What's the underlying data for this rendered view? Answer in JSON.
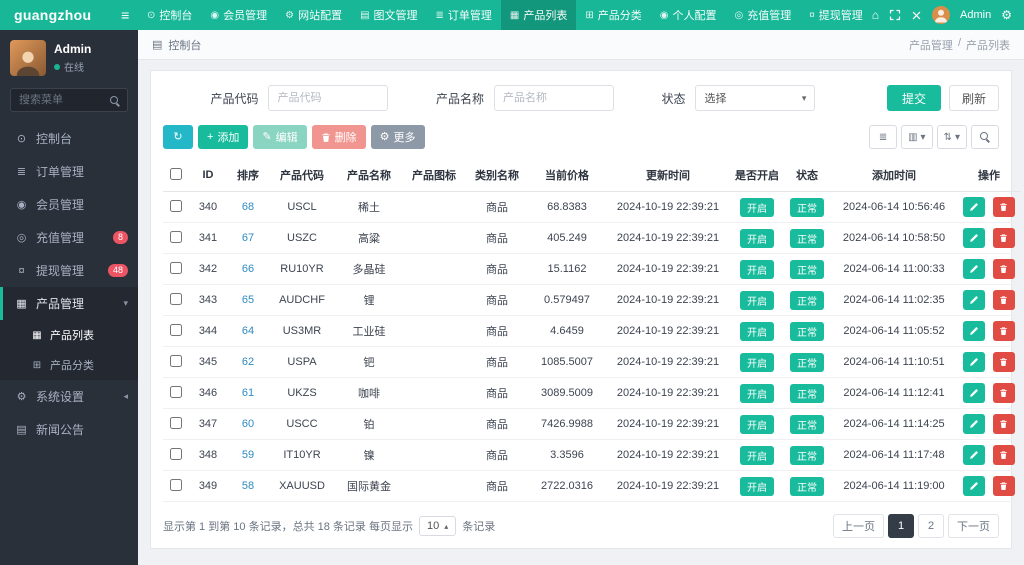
{
  "colors": {
    "accent": "#18bc9c",
    "danger": "#ed5565",
    "topbar": "#17b798",
    "sidebar": "#2a303a",
    "info": "#23b7c8"
  },
  "icons": {
    "menu_toggle": "≡",
    "home": "⌂",
    "gear": "⚙",
    "caret_down": "▾",
    "caret_left": "◂",
    "caret_up": "▴",
    "refresh": "↻",
    "plus": "+",
    "pencil": "✎",
    "list_view": "≣",
    "columns": "▥",
    "sort": "⇅"
  },
  "topbar": {
    "brand": "guangzhou",
    "user": "Admin",
    "nav": [
      {
        "label": "控制台",
        "glyph": "⊙"
      },
      {
        "label": "会员管理",
        "glyph": "◉"
      },
      {
        "label": "网站配置",
        "glyph": "⚙"
      },
      {
        "label": "图文管理",
        "glyph": "▤"
      },
      {
        "label": "订单管理",
        "glyph": "≣"
      },
      {
        "label": "产品列表",
        "glyph": "▦"
      },
      {
        "label": "产品分类",
        "glyph": "⊞"
      },
      {
        "label": "个人配置",
        "glyph": "◉"
      },
      {
        "label": "充值管理",
        "glyph": "◎"
      },
      {
        "label": "提现管理",
        "glyph": "¤"
      }
    ]
  },
  "sidebar": {
    "user_name": "Admin",
    "online_status": "在线",
    "search_placeholder": "搜索菜单",
    "items": [
      {
        "label": "控制台",
        "glyph": "⊙"
      },
      {
        "label": "订单管理",
        "glyph": "≣"
      },
      {
        "label": "会员管理",
        "glyph": "◉"
      },
      {
        "label": "充值管理",
        "glyph": "◎",
        "badge": "8"
      },
      {
        "label": "提现管理",
        "glyph": "¤",
        "badge": "48"
      },
      {
        "label": "产品管理",
        "glyph": "▦",
        "caret": "▾"
      },
      {
        "label": "系统设置",
        "glyph": "⚙",
        "caret": "◂"
      },
      {
        "label": "新闻公告",
        "glyph": "▤"
      }
    ],
    "sub_items": [
      {
        "label": "产品列表",
        "glyph": "▦"
      },
      {
        "label": "产品分类",
        "glyph": "⊞"
      }
    ]
  },
  "breadcrumb": {
    "left": "控制台",
    "section": "产品管理",
    "separator": "/",
    "page": "产品列表"
  },
  "filters": {
    "code_label": "产品代码",
    "code_placeholder": "产品代码",
    "name_label": "产品名称",
    "name_placeholder": "产品名称",
    "status_label": "状态",
    "status_value": "选择",
    "submit_label": "提交",
    "reset_label": "刷新"
  },
  "toolbar": {
    "add_label": "添加",
    "edit_label": "编辑",
    "delete_label": "删除",
    "more_label": "更多"
  },
  "table": {
    "headers": [
      "ID",
      "排序",
      "产品代码",
      "产品名称",
      "产品图标",
      "类别名称",
      "当前价格",
      "更新时间",
      "是否开启",
      "状态",
      "添加时间",
      "操作"
    ],
    "rows": [
      {
        "id": "340",
        "sort": "68",
        "code": "USCL",
        "name": "稀土",
        "category": "商品",
        "price": "68.8383",
        "updated_at": "2024-10-19 22:39:21",
        "open_label": "开启",
        "status_label": "正常",
        "created_at": "2024-06-14 10:56:46"
      },
      {
        "id": "341",
        "sort": "67",
        "code": "USZC",
        "name": "高粱",
        "category": "商品",
        "price": "405.249",
        "updated_at": "2024-10-19 22:39:21",
        "open_label": "开启",
        "status_label": "正常",
        "created_at": "2024-06-14 10:58:50"
      },
      {
        "id": "342",
        "sort": "66",
        "code": "RU10YR",
        "name": "多晶硅",
        "category": "商品",
        "price": "15.1162",
        "updated_at": "2024-10-19 22:39:21",
        "open_label": "开启",
        "status_label": "正常",
        "created_at": "2024-06-14 11:00:33"
      },
      {
        "id": "343",
        "sort": "65",
        "code": "AUDCHF",
        "name": "锂",
        "category": "商品",
        "price": "0.579497",
        "updated_at": "2024-10-19 22:39:21",
        "open_label": "开启",
        "status_label": "正常",
        "created_at": "2024-06-14 11:02:35"
      },
      {
        "id": "344",
        "sort": "64",
        "code": "US3MR",
        "name": "工业硅",
        "category": "商品",
        "price": "4.6459",
        "updated_at": "2024-10-19 22:39:21",
        "open_label": "开启",
        "status_label": "正常",
        "created_at": "2024-06-14 11:05:52"
      },
      {
        "id": "345",
        "sort": "62",
        "code": "USPA",
        "name": "钯",
        "category": "商品",
        "price": "1085.5007",
        "updated_at": "2024-10-19 22:39:21",
        "open_label": "开启",
        "status_label": "正常",
        "created_at": "2024-06-14 11:10:51"
      },
      {
        "id": "346",
        "sort": "61",
        "code": "UKZS",
        "name": "咖啡",
        "category": "商品",
        "price": "3089.5009",
        "updated_at": "2024-10-19 22:39:21",
        "open_label": "开启",
        "status_label": "正常",
        "created_at": "2024-06-14 11:12:41"
      },
      {
        "id": "347",
        "sort": "60",
        "code": "USCC",
        "name": "铂",
        "category": "商品",
        "price": "7426.9988",
        "updated_at": "2024-10-19 22:39:21",
        "open_label": "开启",
        "status_label": "正常",
        "created_at": "2024-06-14 11:14:25"
      },
      {
        "id": "348",
        "sort": "59",
        "code": "IT10YR",
        "name": "镍",
        "category": "商品",
        "price": "3.3596",
        "updated_at": "2024-10-19 22:39:21",
        "open_label": "开启",
        "status_label": "正常",
        "created_at": "2024-06-14 11:17:48"
      },
      {
        "id": "349",
        "sort": "58",
        "code": "XAUUSD",
        "name": "国际黄金",
        "category": "商品",
        "price": "2722.0316",
        "updated_at": "2024-10-19 22:39:21",
        "open_label": "开启",
        "status_label": "正常",
        "created_at": "2024-06-14 11:19:00"
      }
    ]
  },
  "footer": {
    "summary_before": "显示第 1 到第 10 条记录，总共 18 条记录 每页显示",
    "page_size": "10",
    "summary_after": "条记录",
    "prev": "上一页",
    "pages": [
      "1",
      "2"
    ],
    "active_page": "1",
    "next": "下一页"
  }
}
